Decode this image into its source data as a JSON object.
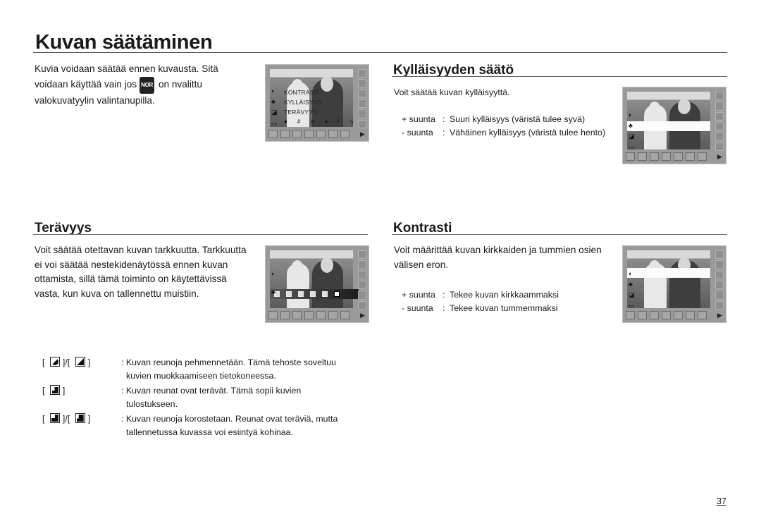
{
  "page": {
    "title": "Kuvan säätäminen",
    "page_number": "37"
  },
  "intro": {
    "line1": "Kuvia voidaan säätää ennen kuvausta. Sitä",
    "line2_a": "voidaan käyttää vain jos",
    "mode_badge": "NOR",
    "line2_b": "on nvalittu",
    "line3": "valokuvatyylin valintanupilla.",
    "screen": {
      "menu_items": [
        "KONTRASTI",
        "KYLLÄISYYS",
        "TERÄVYYS"
      ]
    }
  },
  "saturation": {
    "title": "Kylläisyyden säätö",
    "description": "Voit säätää kuvan kylläisyyttä.",
    "items": [
      {
        "key": "+ suunta",
        "sep": ":",
        "text": "Suuri kylläisyys (väristä tulee syvä)"
      },
      {
        "key": "- suunta",
        "sep": ":",
        "text": "Vähäinen kylläisyys (väristä tulee hento)"
      }
    ]
  },
  "sharpness": {
    "title": "Terävyys",
    "lines": [
      "Voit säätää otettavan kuvan tarkkuutta. Tarkkuutta",
      "ei voi säätää nestekidenäytössä ennen kuvan",
      "ottamista, sillä tämä toiminto on käytettävissä",
      "vasta, kun kuva on tallennettu muistiin."
    ],
    "options": [
      {
        "icons": [
          "soft-2-icon",
          "soft-1-icon"
        ],
        "sep": ":",
        "lines": [
          "Kuvan reunoja pehmennetään. Tämä tehoste soveltuu",
          "kuvien muokkaamiseen tietokoneessa."
        ]
      },
      {
        "icons": [
          "normal-sharp-icon"
        ],
        "sep": ":",
        "lines": [
          "Kuvan reunat ovat terävät. Tämä sopii kuvien",
          "tulostukseen."
        ]
      },
      {
        "icons": [
          "vivid-1-icon",
          "vivid-2-icon"
        ],
        "sep": ":",
        "lines": [
          "Kuvan reunoja korostetaan. Reunat ovat teräviä, mutta",
          "tallennetussa kuvassa voi esiintyä kohinaa."
        ]
      }
    ],
    "bracket_open": "[",
    "bracket_close": "]",
    "bracket_join": "]/["
  },
  "contrast": {
    "title": "Kontrasti",
    "lines": [
      "Voit määrittää kuvan kirkkaiden ja tummien osien",
      "välisen eron."
    ],
    "items": [
      {
        "key": "+ suunta",
        "sep": ":",
        "text": "Tekee kuvan kirkkaammaksi"
      },
      {
        "key": "- suunta",
        "sep": ":",
        "text": "Tekee kuvan tummemmaksi"
      }
    ]
  }
}
